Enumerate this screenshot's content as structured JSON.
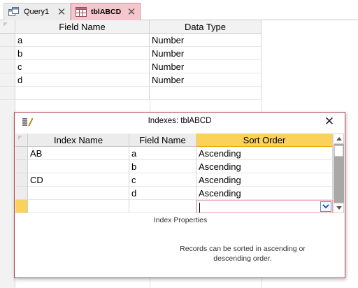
{
  "tabs": [
    {
      "label": "Query1",
      "icon": "query-icon",
      "active": false
    },
    {
      "label": "tblABCD",
      "icon": "table-icon",
      "active": true
    }
  ],
  "design_grid": {
    "headers": {
      "field_name": "Field Name",
      "data_type": "Data Type"
    },
    "rows": [
      {
        "field_name": "a",
        "data_type": "Number"
      },
      {
        "field_name": "b",
        "data_type": "Number"
      },
      {
        "field_name": "c",
        "data_type": "Number"
      },
      {
        "field_name": "d",
        "data_type": "Number"
      }
    ]
  },
  "indexes_dialog": {
    "title": "Indexes: tblABCD",
    "headers": {
      "index_name": "Index Name",
      "field_name": "Field Name",
      "sort_order": "Sort Order"
    },
    "rows": [
      {
        "index_name": "AB",
        "field_name": "a",
        "sort_order": "Ascending"
      },
      {
        "index_name": "",
        "field_name": "b",
        "sort_order": "Ascending"
      },
      {
        "index_name": "CD",
        "field_name": "c",
        "sort_order": "Ascending"
      },
      {
        "index_name": "",
        "field_name": "d",
        "sort_order": "Ascending"
      },
      {
        "index_name": "",
        "field_name": "",
        "sort_order": ""
      }
    ],
    "properties_label": "Index Properties",
    "help_text": "Records can be sorted in ascending or descending order."
  },
  "colors": {
    "active_tab": "#f5c6cd",
    "active_header": "#fad25a",
    "dialog_border": "#b0404f"
  }
}
